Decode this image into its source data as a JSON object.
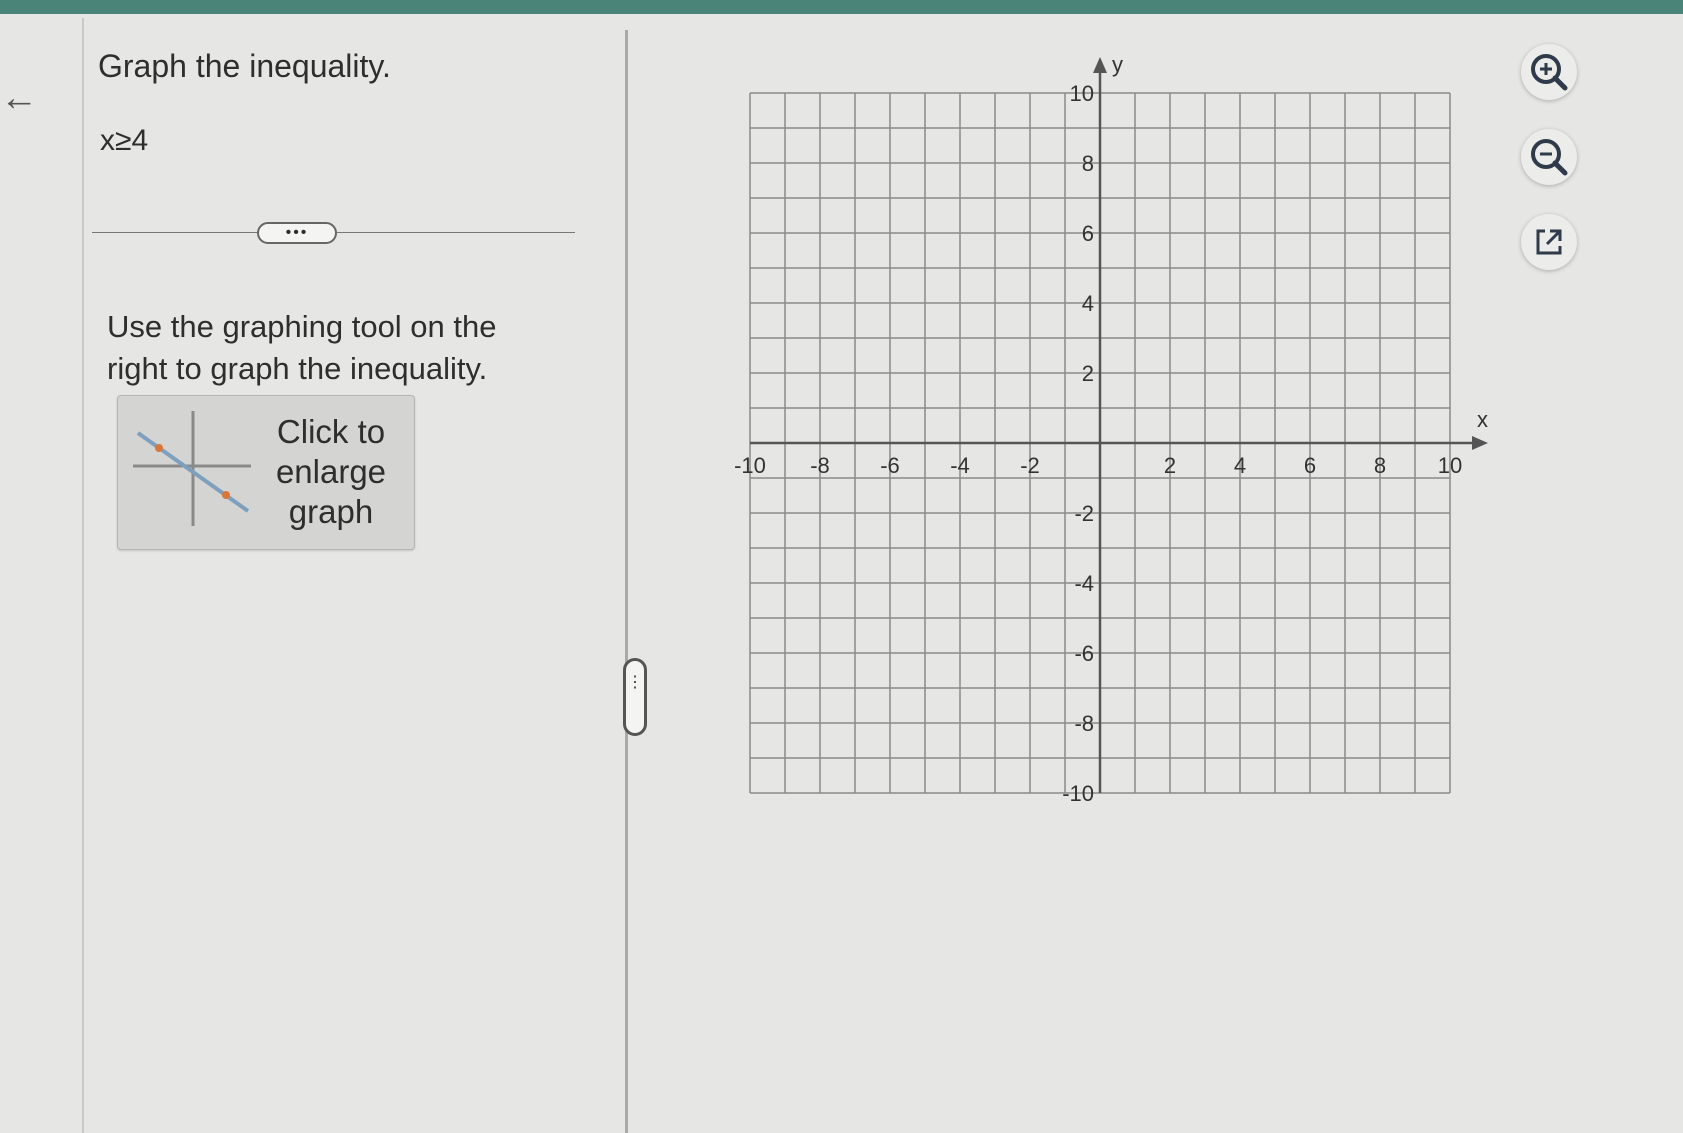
{
  "question": {
    "title": "Graph the inequality.",
    "inequality": "x≥4",
    "more_label": "•••"
  },
  "instructions": "Use the graphing tool on the right to graph the inequality.",
  "enlarge_button": {
    "line1": "Click to",
    "line2": "enlarge",
    "line3": "graph"
  },
  "graph": {
    "x_axis_label": "x",
    "y_axis_label": "y",
    "range": [
      -10,
      10
    ],
    "grid_step": 1,
    "x_ticks": [
      "-10",
      "-8",
      "-6",
      "-4",
      "-2",
      "2",
      "4",
      "6",
      "8",
      "10"
    ],
    "y_ticks": [
      "10",
      "8",
      "6",
      "4",
      "2",
      "-2",
      "-4",
      "-6",
      "-8",
      "-10"
    ]
  },
  "tools": {
    "zoom_in_icon": "zoom-in-icon",
    "zoom_out_icon": "zoom-out-icon",
    "popout_icon": "external-link-icon"
  },
  "colors": {
    "top_bar": "#4a8377",
    "grid": "#8a8a8a",
    "axis": "#555555"
  }
}
